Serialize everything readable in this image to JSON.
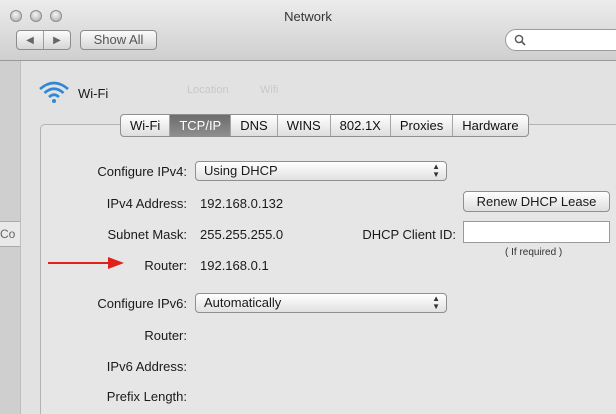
{
  "window": {
    "title": "Network"
  },
  "toolbar": {
    "back_label": "◀",
    "forward_label": "▶",
    "show_all_label": "Show All",
    "search_placeholder": ""
  },
  "sidebar": {
    "fragment_label": "Co"
  },
  "service": {
    "name": "Wi-Fi",
    "faded_location": "Location",
    "faded_location_value": "Wifi"
  },
  "tabs": [
    "Wi-Fi",
    "TCP/IP",
    "DNS",
    "WINS",
    "802.1X",
    "Proxies",
    "Hardware"
  ],
  "active_tab": "TCP/IP",
  "ipv4": {
    "configure_label": "Configure IPv4:",
    "configure_value": "Using DHCP",
    "address_label": "IPv4 Address:",
    "address_value": "192.168.0.132",
    "subnet_label": "Subnet Mask:",
    "subnet_value": "255.255.255.0",
    "router_label": "Router:",
    "router_value": "192.168.0.1"
  },
  "dhcp": {
    "renew_label": "Renew DHCP Lease",
    "client_id_label": "DHCP Client ID:",
    "client_id_value": "",
    "client_id_hint": "( If required )"
  },
  "ipv6": {
    "configure_label": "Configure IPv6:",
    "configure_value": "Automatically",
    "router_label": "Router:",
    "address_label": "IPv6 Address:",
    "prefix_label": "Prefix Length:"
  },
  "colors": {
    "annotation_arrow": "#e0201b",
    "active_tab": "#7a7a7a"
  }
}
